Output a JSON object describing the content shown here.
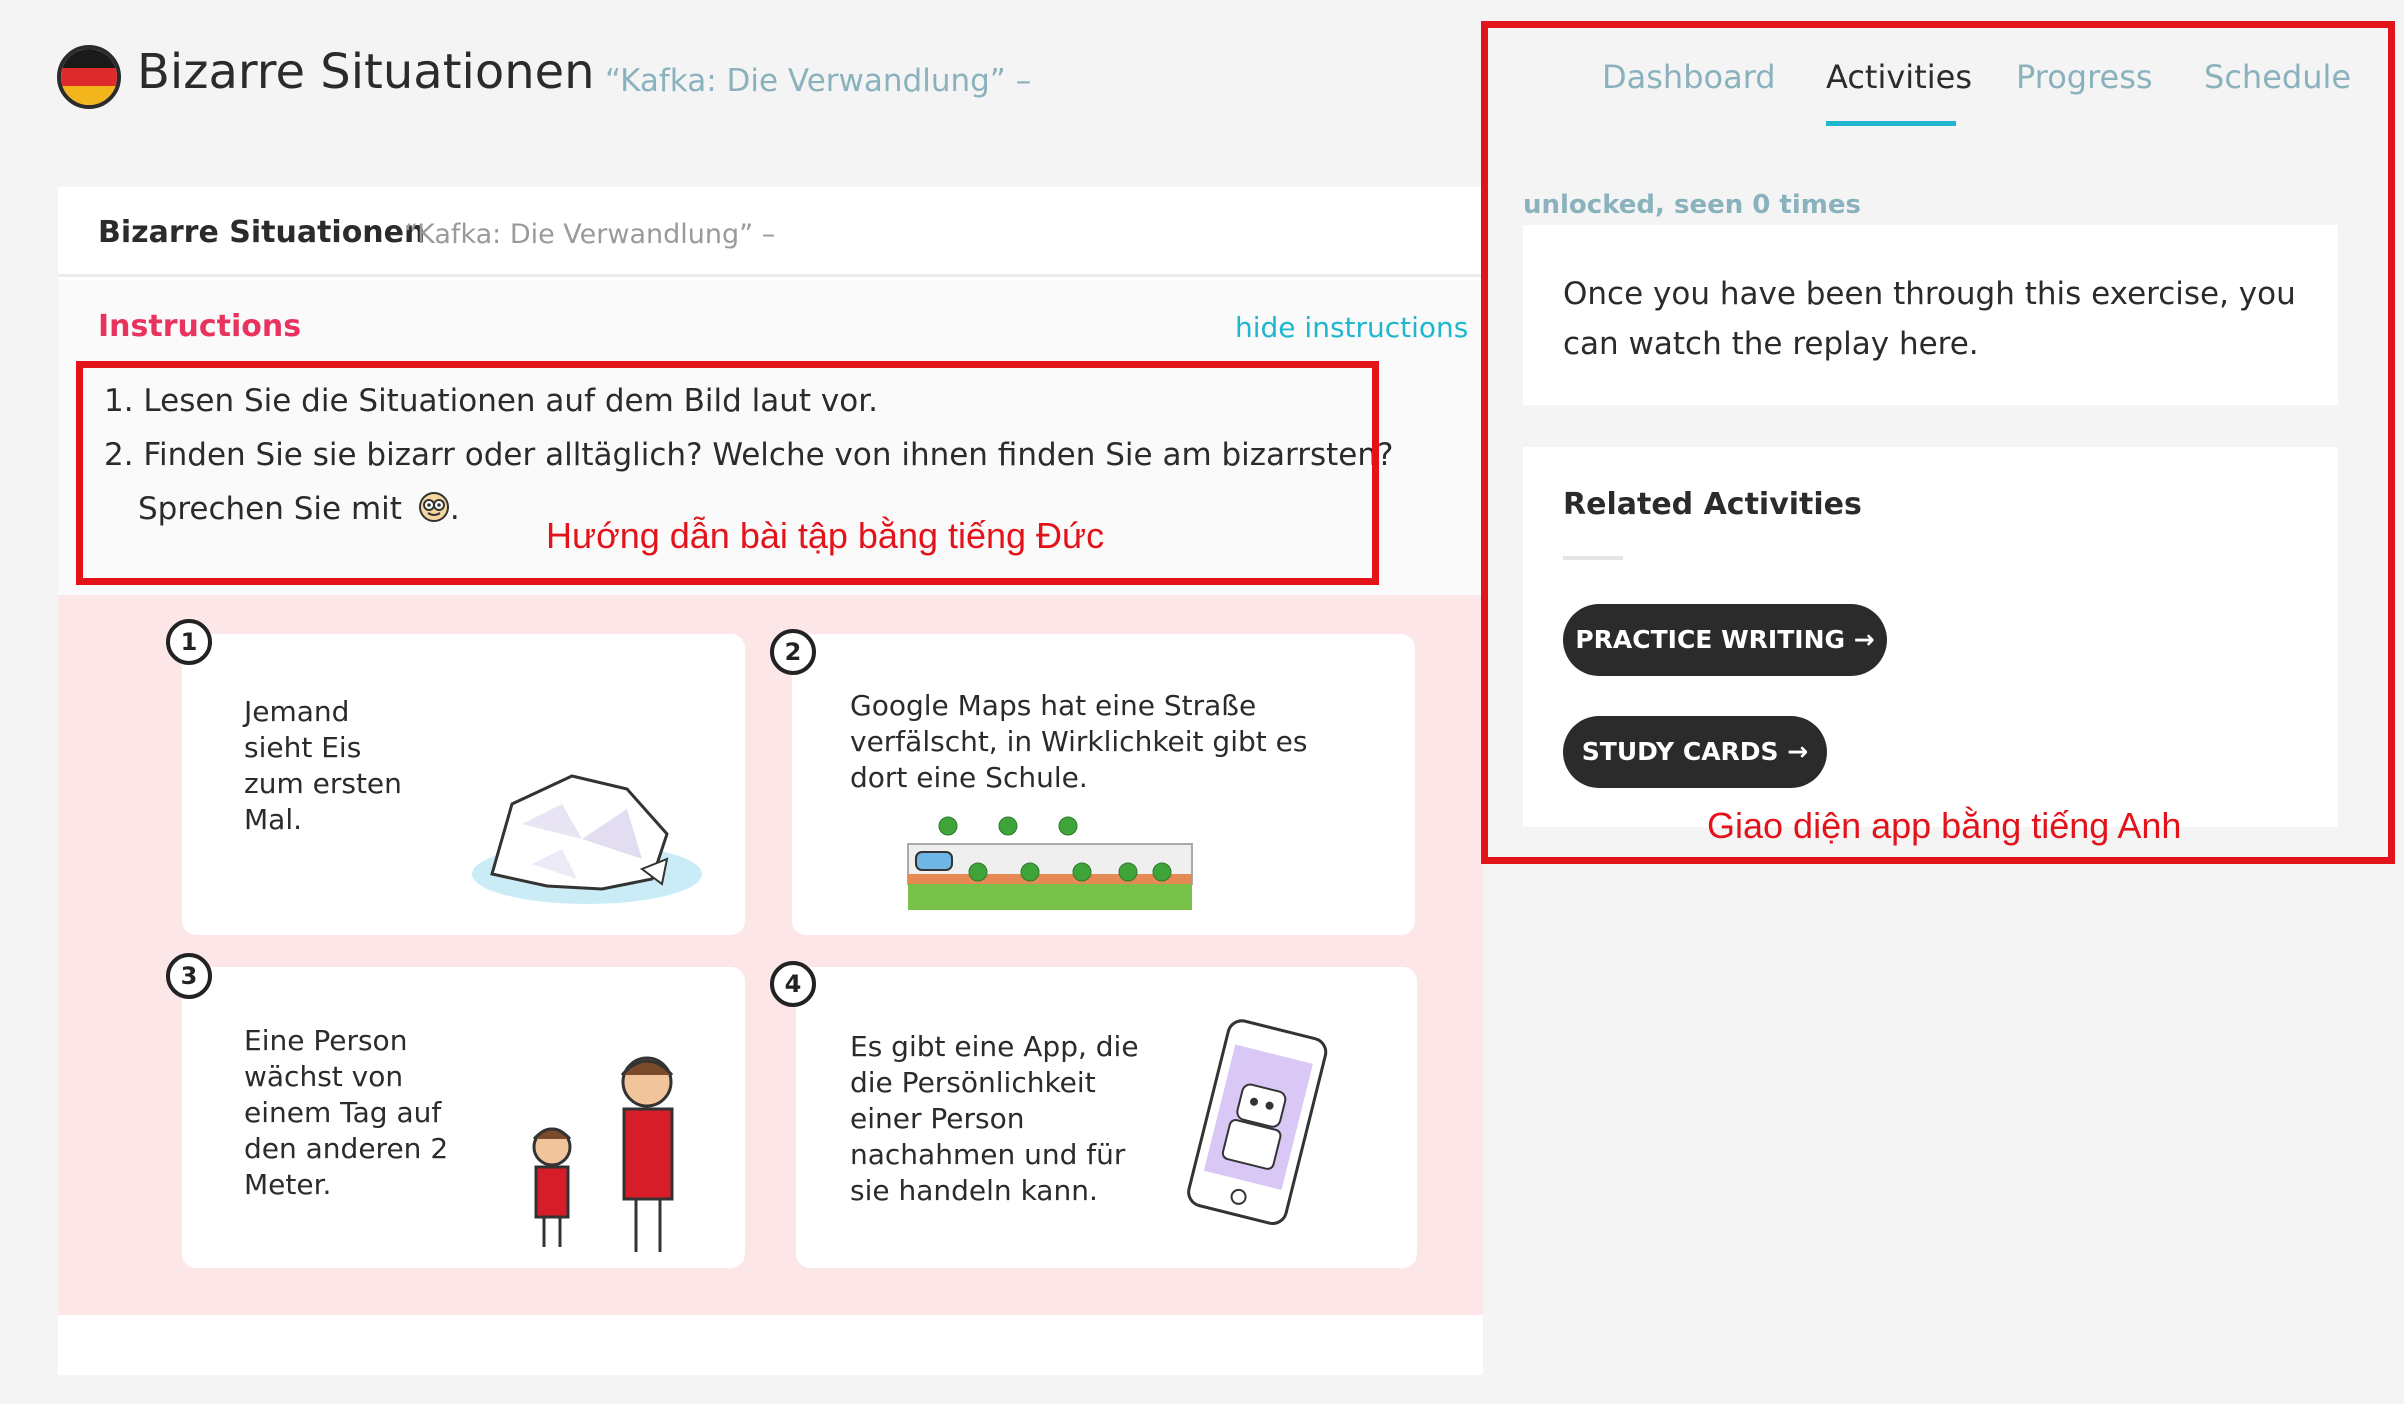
{
  "header": {
    "title": "Bizarre Situationen",
    "subtitle": "“Kafka: Die Verwandlung” –"
  },
  "card": {
    "title": "Bizarre Situationen",
    "subtitle": "“Kafka: Die Verwandlung” –",
    "instructions_title": "Instructions",
    "hide_link": "hide instructions",
    "instructions": [
      "1. Lesen Sie die Situationen auf dem Bild laut vor.",
      "2. Finden Sie sie bizarr oder alltäglich? Welche von ihnen finden Sie am bizarrsten?",
      "Sprechen Sie mit"
    ],
    "instructions_end": "."
  },
  "exercises": [
    {
      "num": "1",
      "lines": [
        "Jemand",
        "sieht Eis",
        "zum ersten",
        "Mal."
      ]
    },
    {
      "num": "2",
      "lines": [
        "Google Maps hat eine Straße",
        "verfälscht, in Wirklichkeit gibt es",
        "dort eine Schule."
      ]
    },
    {
      "num": "3",
      "lines": [
        "Eine Person",
        "wächst von",
        "einem Tag auf",
        "den anderen 2",
        "Meter."
      ]
    },
    {
      "num": "4",
      "lines": [
        "Es gibt eine App, die",
        "die Persönlichkeit",
        "einer Person",
        "nachahmen und für",
        "sie handeln kann."
      ]
    }
  ],
  "annotations": {
    "german_label": "Hướng dẫn bài tập bằng tiếng Đức",
    "english_label": "Giao diện app bằng tiếng Anh"
  },
  "tabs": [
    {
      "label": "Dashboard",
      "active": false
    },
    {
      "label": "Activities",
      "active": true
    },
    {
      "label": "Progress",
      "active": false
    },
    {
      "label": "Schedule",
      "active": false
    }
  ],
  "sidebar": {
    "status": "unlocked, seen 0 times",
    "replay_text": "Once you have been through this exercise, you can watch the replay here.",
    "related_title": "Related Activities",
    "buttons": [
      {
        "label": "PRACTICE WRITING →"
      },
      {
        "label": "STUDY CARDS →"
      }
    ]
  },
  "colors": {
    "accent": "#1fb6cf",
    "instructions": "#e8335f",
    "annotation": "#e3131b",
    "worksheet_bg": "#fde6e7",
    "muted": "#8ab2bd"
  }
}
